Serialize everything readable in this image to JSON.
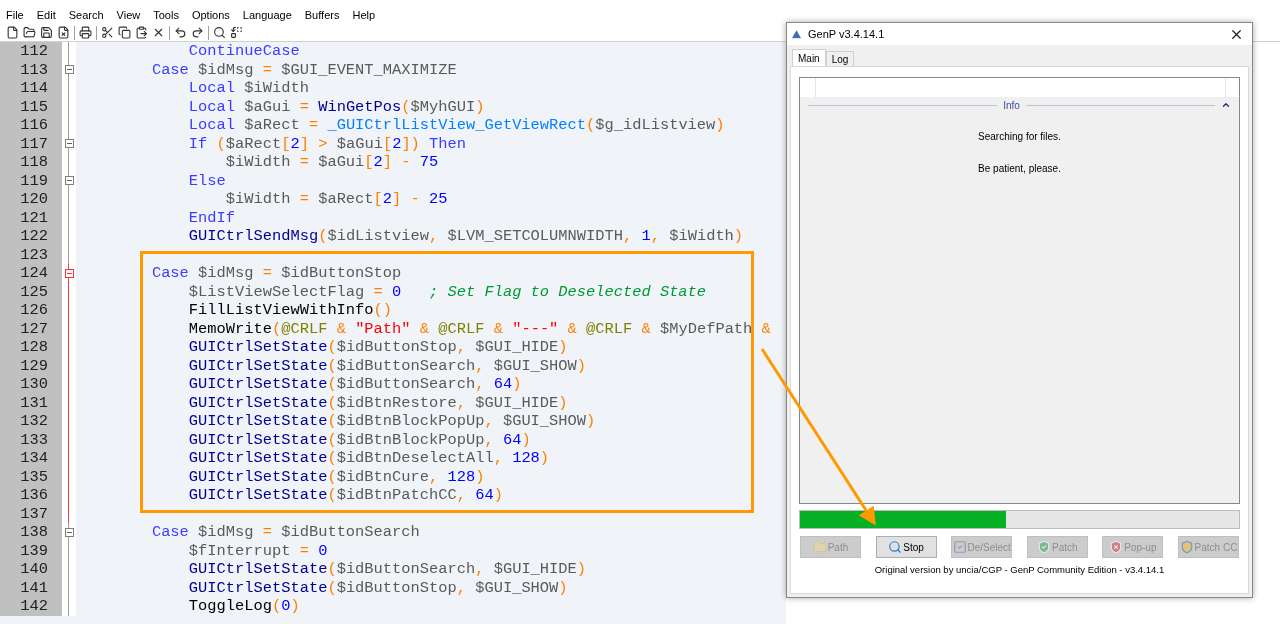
{
  "menu": [
    "File",
    "Edit",
    "Search",
    "View",
    "Tools",
    "Options",
    "Language",
    "Buffers",
    "Help"
  ],
  "editor": {
    "lines": [
      {
        "number": "112",
        "fold_marker": false,
        "current_block": false,
        "tokens": [
          {
            "kind": "keyword",
            "text": "            ContinueCase"
          }
        ]
      },
      {
        "number": "113",
        "fold_marker": true,
        "current_block": false,
        "tokens": [
          {
            "kind": "keyword",
            "text": "        Case"
          },
          {
            "kind": "variable",
            "text": " $idMsg "
          },
          {
            "kind": "operator",
            "text": "="
          },
          {
            "kind": "variable",
            "text": " $GUI_EVENT_MAXIMIZE"
          }
        ]
      },
      {
        "number": "114",
        "fold_marker": false,
        "current_block": false,
        "tokens": [
          {
            "kind": "keyword",
            "text": "            Local"
          },
          {
            "kind": "variable",
            "text": " $iWidth"
          }
        ]
      },
      {
        "number": "115",
        "fold_marker": false,
        "current_block": false,
        "tokens": [
          {
            "kind": "keyword",
            "text": "            Local"
          },
          {
            "kind": "variable",
            "text": " $aGui "
          },
          {
            "kind": "operator",
            "text": "="
          },
          {
            "kind": "function",
            "text": " WinGetPos"
          },
          {
            "kind": "operator",
            "text": "("
          },
          {
            "kind": "variable",
            "text": "$MyhGUI"
          },
          {
            "kind": "operator",
            "text": ")"
          }
        ]
      },
      {
        "number": "116",
        "fold_marker": false,
        "current_block": false,
        "tokens": [
          {
            "kind": "keyword",
            "text": "            Local"
          },
          {
            "kind": "variable",
            "text": " $aRect "
          },
          {
            "kind": "operator",
            "text": "="
          },
          {
            "kind": "library",
            "text": " _GUICtrlListView_GetViewRect"
          },
          {
            "kind": "operator",
            "text": "("
          },
          {
            "kind": "variable",
            "text": "$g_idListview"
          },
          {
            "kind": "operator",
            "text": ")"
          }
        ]
      },
      {
        "number": "117",
        "fold_marker": true,
        "current_block": false,
        "tokens": [
          {
            "kind": "keyword",
            "text": "            If"
          },
          {
            "kind": "operator",
            "text": " ("
          },
          {
            "kind": "variable",
            "text": "$aRect"
          },
          {
            "kind": "operator",
            "text": "["
          },
          {
            "kind": "number",
            "text": "2"
          },
          {
            "kind": "operator",
            "text": "] > "
          },
          {
            "kind": "variable",
            "text": "$aGui"
          },
          {
            "kind": "operator",
            "text": "["
          },
          {
            "kind": "number",
            "text": "2"
          },
          {
            "kind": "operator",
            "text": "])"
          },
          {
            "kind": "keyword",
            "text": " Then"
          }
        ]
      },
      {
        "number": "118",
        "fold_marker": false,
        "current_block": false,
        "tokens": [
          {
            "kind": "variable",
            "text": "                $iWidth "
          },
          {
            "kind": "operator",
            "text": "="
          },
          {
            "kind": "variable",
            "text": " $aGui"
          },
          {
            "kind": "operator",
            "text": "["
          },
          {
            "kind": "number",
            "text": "2"
          },
          {
            "kind": "operator",
            "text": "] - "
          },
          {
            "kind": "number",
            "text": "75"
          }
        ]
      },
      {
        "number": "119",
        "fold_marker": true,
        "current_block": false,
        "tokens": [
          {
            "kind": "keyword",
            "text": "            Else"
          }
        ]
      },
      {
        "number": "120",
        "fold_marker": false,
        "current_block": false,
        "tokens": [
          {
            "kind": "variable",
            "text": "                $iWidth "
          },
          {
            "kind": "operator",
            "text": "="
          },
          {
            "kind": "variable",
            "text": " $aRect"
          },
          {
            "kind": "operator",
            "text": "["
          },
          {
            "kind": "number",
            "text": "2"
          },
          {
            "kind": "operator",
            "text": "] - "
          },
          {
            "kind": "number",
            "text": "25"
          }
        ]
      },
      {
        "number": "121",
        "fold_marker": false,
        "current_block": false,
        "tokens": [
          {
            "kind": "keyword",
            "text": "            EndIf"
          }
        ]
      },
      {
        "number": "122",
        "fold_marker": false,
        "current_block": false,
        "tokens": [
          {
            "kind": "function",
            "text": "            GUICtrlSendMsg"
          },
          {
            "kind": "operator",
            "text": "("
          },
          {
            "kind": "variable",
            "text": "$idListview"
          },
          {
            "kind": "operator",
            "text": ", "
          },
          {
            "kind": "variable",
            "text": "$LVM_SETCOLUMNWIDTH"
          },
          {
            "kind": "operator",
            "text": ", "
          },
          {
            "kind": "number",
            "text": "1"
          },
          {
            "kind": "operator",
            "text": ", "
          },
          {
            "kind": "variable",
            "text": "$iWidth"
          },
          {
            "kind": "operator",
            "text": ")"
          }
        ]
      },
      {
        "number": "123",
        "fold_marker": false,
        "current_block": false
      },
      {
        "number": "124",
        "fold_marker": true,
        "current_block": true,
        "tokens": [
          {
            "kind": "keyword",
            "text": "        Case"
          },
          {
            "kind": "variable",
            "text": " $idMsg "
          },
          {
            "kind": "operator",
            "text": "="
          },
          {
            "kind": "variable",
            "text": " $idButtonStop"
          }
        ]
      },
      {
        "number": "125",
        "fold_marker": false,
        "current_block": true,
        "tokens": [
          {
            "kind": "variable",
            "text": "            $ListViewSelectFlag "
          },
          {
            "kind": "operator",
            "text": "="
          },
          {
            "kind": "number",
            "text": " 0"
          },
          {
            "kind": "comment",
            "text": "   ; Set Flag to Deselected State"
          }
        ]
      },
      {
        "number": "126",
        "fold_marker": false,
        "current_block": true,
        "tokens": [
          {
            "kind": "user",
            "text": "            FillListViewWithInfo"
          },
          {
            "kind": "operator",
            "text": "()"
          }
        ]
      },
      {
        "number": "127",
        "fold_marker": false,
        "current_block": true,
        "tokens": [
          {
            "kind": "user",
            "text": "            MemoWrite"
          },
          {
            "kind": "operator",
            "text": "("
          },
          {
            "kind": "macro",
            "text": "@CRLF"
          },
          {
            "kind": "operator",
            "text": " & "
          },
          {
            "kind": "string",
            "text": "\"Path\""
          },
          {
            "kind": "operator",
            "text": " & "
          },
          {
            "kind": "macro",
            "text": "@CRLF"
          },
          {
            "kind": "operator",
            "text": " & "
          },
          {
            "kind": "string",
            "text": "\"---\""
          },
          {
            "kind": "operator",
            "text": " & "
          },
          {
            "kind": "macro",
            "text": "@CRLF"
          },
          {
            "kind": "operator",
            "text": " & "
          },
          {
            "kind": "variable",
            "text": "$MyDefPath"
          },
          {
            "kind": "operator",
            "text": " &"
          }
        ]
      },
      {
        "number": "128",
        "fold_marker": false,
        "current_block": true,
        "tokens": [
          {
            "kind": "function",
            "text": "            GUICtrlSetState"
          },
          {
            "kind": "operator",
            "text": "("
          },
          {
            "kind": "variable",
            "text": "$idButtonStop"
          },
          {
            "kind": "operator",
            "text": ", "
          },
          {
            "kind": "variable",
            "text": "$GUI_HIDE"
          },
          {
            "kind": "operator",
            "text": ")"
          }
        ]
      },
      {
        "number": "129",
        "fold_marker": false,
        "current_block": true,
        "tokens": [
          {
            "kind": "function",
            "text": "            GUICtrlSetState"
          },
          {
            "kind": "operator",
            "text": "("
          },
          {
            "kind": "variable",
            "text": "$idButtonSearch"
          },
          {
            "kind": "operator",
            "text": ", "
          },
          {
            "kind": "variable",
            "text": "$GUI_SHOW"
          },
          {
            "kind": "operator",
            "text": ")"
          }
        ]
      },
      {
        "number": "130",
        "fold_marker": false,
        "current_block": true,
        "tokens": [
          {
            "kind": "function",
            "text": "            GUICtrlSetState"
          },
          {
            "kind": "operator",
            "text": "("
          },
          {
            "kind": "variable",
            "text": "$idButtonSearch"
          },
          {
            "kind": "operator",
            "text": ", "
          },
          {
            "kind": "number",
            "text": "64"
          },
          {
            "kind": "operator",
            "text": ")"
          }
        ]
      },
      {
        "number": "131",
        "fold_marker": false,
        "current_block": true,
        "tokens": [
          {
            "kind": "function",
            "text": "            GUICtrlSetState"
          },
          {
            "kind": "operator",
            "text": "("
          },
          {
            "kind": "variable",
            "text": "$idBtnRestore"
          },
          {
            "kind": "operator",
            "text": ", "
          },
          {
            "kind": "variable",
            "text": "$GUI_HIDE"
          },
          {
            "kind": "operator",
            "text": ")"
          }
        ]
      },
      {
        "number": "132",
        "fold_marker": false,
        "current_block": true,
        "tokens": [
          {
            "kind": "function",
            "text": "            GUICtrlSetState"
          },
          {
            "kind": "operator",
            "text": "("
          },
          {
            "kind": "variable",
            "text": "$idBtnBlockPopUp"
          },
          {
            "kind": "operator",
            "text": ", "
          },
          {
            "kind": "variable",
            "text": "$GUI_SHOW"
          },
          {
            "kind": "operator",
            "text": ")"
          }
        ]
      },
      {
        "number": "133",
        "fold_marker": false,
        "current_block": true,
        "tokens": [
          {
            "kind": "function",
            "text": "            GUICtrlSetState"
          },
          {
            "kind": "operator",
            "text": "("
          },
          {
            "kind": "variable",
            "text": "$idBtnBlockPopUp"
          },
          {
            "kind": "operator",
            "text": ", "
          },
          {
            "kind": "number",
            "text": "64"
          },
          {
            "kind": "operator",
            "text": ")"
          }
        ]
      },
      {
        "number": "134",
        "fold_marker": false,
        "current_block": true,
        "tokens": [
          {
            "kind": "function",
            "text": "            GUICtrlSetState"
          },
          {
            "kind": "operator",
            "text": "("
          },
          {
            "kind": "variable",
            "text": "$idBtnDeselectAll"
          },
          {
            "kind": "operator",
            "text": ", "
          },
          {
            "kind": "number",
            "text": "128"
          },
          {
            "kind": "operator",
            "text": ")"
          }
        ]
      },
      {
        "number": "135",
        "fold_marker": false,
        "current_block": true,
        "tokens": [
          {
            "kind": "function",
            "text": "            GUICtrlSetState"
          },
          {
            "kind": "operator",
            "text": "("
          },
          {
            "kind": "variable",
            "text": "$idBtnCure"
          },
          {
            "kind": "operator",
            "text": ", "
          },
          {
            "kind": "number",
            "text": "128"
          },
          {
            "kind": "operator",
            "text": ")"
          }
        ]
      },
      {
        "number": "136",
        "fold_marker": false,
        "current_block": true,
        "tokens": [
          {
            "kind": "function",
            "text": "            GUICtrlSetState"
          },
          {
            "kind": "operator",
            "text": "("
          },
          {
            "kind": "variable",
            "text": "$idBtnPatchCC"
          },
          {
            "kind": "operator",
            "text": ", "
          },
          {
            "kind": "number",
            "text": "64"
          },
          {
            "kind": "operator",
            "text": ")"
          }
        ]
      },
      {
        "number": "137",
        "fold_marker": false,
        "current_block": true
      },
      {
        "number": "138",
        "fold_marker": true,
        "current_block": false,
        "tokens": [
          {
            "kind": "keyword",
            "text": "        Case"
          },
          {
            "kind": "variable",
            "text": " $idMsg "
          },
          {
            "kind": "operator",
            "text": "="
          },
          {
            "kind": "variable",
            "text": " $idButtonSearch"
          }
        ]
      },
      {
        "number": "139",
        "fold_marker": false,
        "current_block": false,
        "tokens": [
          {
            "kind": "variable",
            "text": "            $fInterrupt "
          },
          {
            "kind": "operator",
            "text": "="
          },
          {
            "kind": "number",
            "text": " 0"
          }
        ]
      },
      {
        "number": "140",
        "fold_marker": false,
        "current_block": false,
        "tokens": [
          {
            "kind": "function",
            "text": "            GUICtrlSetState"
          },
          {
            "kind": "operator",
            "text": "("
          },
          {
            "kind": "variable",
            "text": "$idButtonSearch"
          },
          {
            "kind": "operator",
            "text": ", "
          },
          {
            "kind": "variable",
            "text": "$GUI_HIDE"
          },
          {
            "kind": "operator",
            "text": ")"
          }
        ]
      },
      {
        "number": "141",
        "fold_marker": false,
        "current_block": false,
        "tokens": [
          {
            "kind": "function",
            "text": "            GUICtrlSetState"
          },
          {
            "kind": "operator",
            "text": "("
          },
          {
            "kind": "variable",
            "text": "$idButtonStop"
          },
          {
            "kind": "operator",
            "text": ", "
          },
          {
            "kind": "variable",
            "text": "$GUI_SHOW"
          },
          {
            "kind": "operator",
            "text": ")"
          }
        ]
      },
      {
        "number": "142",
        "fold_marker": false,
        "current_block": false,
        "tokens": [
          {
            "kind": "user",
            "text": "            ToggleLog"
          },
          {
            "kind": "operator",
            "text": "("
          },
          {
            "kind": "number",
            "text": "0"
          },
          {
            "kind": "operator",
            "text": ")"
          }
        ]
      }
    ]
  },
  "dialog": {
    "title": "GenP v3.4.14.1",
    "tabs": [
      {
        "label": "Main",
        "selected": true
      },
      {
        "label": "Log",
        "selected": false
      }
    ],
    "info": {
      "heading": "Info",
      "messages": [
        "Searching for files.",
        "Be patient, please."
      ]
    },
    "progress": {
      "level": 0.47
    },
    "buttons": [
      {
        "label": "Path",
        "kind": "folder",
        "disabled": true
      },
      {
        "label": "Stop",
        "kind": "search",
        "disabled": false
      },
      {
        "label": "De/Select",
        "kind": "checklist",
        "disabled": true
      },
      {
        "label": "Patch",
        "kind": "shield-check",
        "disabled": true
      },
      {
        "label": "Pop-up",
        "kind": "shield-x",
        "disabled": true
      },
      {
        "label": "Patch CC",
        "kind": "shield",
        "disabled": true
      }
    ],
    "footer": "Original version by uncia/CGP - GenP Community Edition - v3.4.14.1"
  }
}
